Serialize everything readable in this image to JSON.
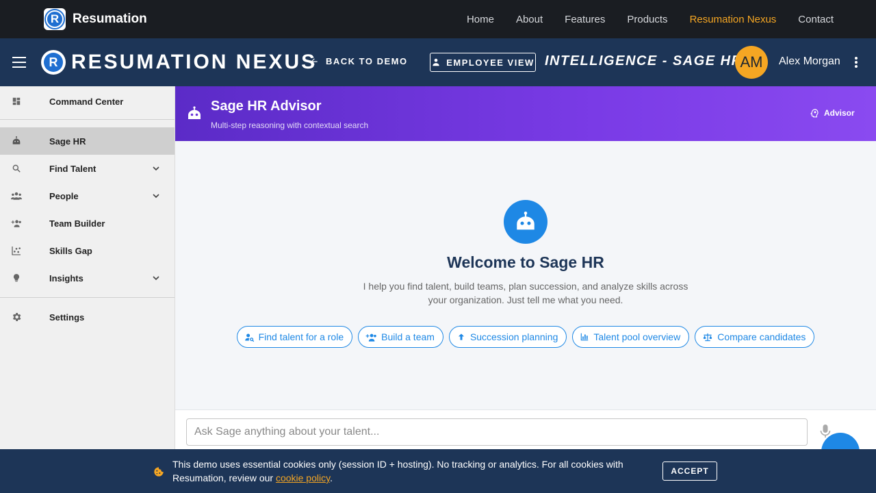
{
  "site_nav": {
    "brand": "Resumation",
    "links": [
      {
        "label": "Home",
        "active": false
      },
      {
        "label": "About",
        "active": false
      },
      {
        "label": "Features",
        "active": false
      },
      {
        "label": "Products",
        "active": false
      },
      {
        "label": "Resumation Nexus",
        "active": true
      },
      {
        "label": "Contact",
        "active": false
      }
    ]
  },
  "app_bar": {
    "title": "RESUMATION NEXUS",
    "back_label": "BACK TO DEMO",
    "employee_view_label": "EMPLOYEE VIEW",
    "section_label": "INTELLIGENCE - SAGE HR",
    "user_initials": "AM",
    "user_name": "Alex Morgan"
  },
  "sidebar": {
    "items": [
      {
        "label": "Command Center",
        "icon": "dashboard-icon"
      },
      {
        "label": "Sage HR",
        "icon": "robot-icon",
        "active": true
      },
      {
        "label": "Find Talent",
        "icon": "search-icon",
        "expandable": true
      },
      {
        "label": "People",
        "icon": "people-icon",
        "expandable": true
      },
      {
        "label": "Team Builder",
        "icon": "group-add-icon"
      },
      {
        "label": "Skills Gap",
        "icon": "scatter-chart-icon"
      },
      {
        "label": "Insights",
        "icon": "lightbulb-icon",
        "expandable": true
      },
      {
        "label": "Settings",
        "icon": "gear-icon"
      }
    ]
  },
  "banner": {
    "title": "Sage HR Advisor",
    "subtitle": "Multi-step reasoning with contextual search",
    "chip": "Advisor"
  },
  "welcome": {
    "title": "Welcome to Sage HR",
    "text": "I help you find talent, build teams, plan succession, and analyze skills across your organization. Just tell me what you need.",
    "chips": [
      {
        "label": "Find talent for a role",
        "icon": "person-search-icon"
      },
      {
        "label": "Build a team",
        "icon": "group-add-icon"
      },
      {
        "label": "Succession planning",
        "icon": "arrow-up-icon"
      },
      {
        "label": "Talent pool overview",
        "icon": "bar-chart-icon"
      },
      {
        "label": "Compare candidates",
        "icon": "scale-icon"
      }
    ]
  },
  "input": {
    "placeholder": "Ask Sage anything about your talent..."
  },
  "cookie": {
    "text": "This demo uses essential cookies only (session ID + hosting). No tracking or analytics. For all cookies with Resumation, review our ",
    "link": "cookie policy",
    "suffix": ".",
    "accept": "ACCEPT"
  },
  "colors": {
    "accent": "#1e88e5",
    "navy": "#1d3557",
    "orange": "#f5a623",
    "purple": "#7a3be6"
  }
}
